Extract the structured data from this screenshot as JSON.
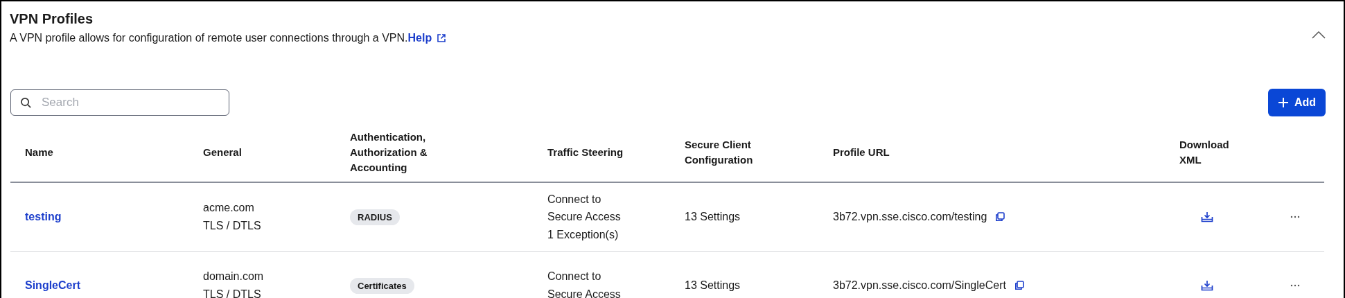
{
  "panel": {
    "title": "VPN Profiles",
    "description": "A VPN profile allows for configuration of remote user connections through a VPN.",
    "help_link": "Help",
    "expanded": true
  },
  "search": {
    "placeholder": "Search"
  },
  "add_button": {
    "label": "Add"
  },
  "table": {
    "columns": [
      "Name",
      "General",
      "Authentication, Authorization & Accounting",
      "Traffic Steering",
      "Secure Client Configuration",
      "Profile URL",
      "Download XML"
    ],
    "rows": [
      {
        "name": "testing",
        "general": [
          "acme.com",
          "TLS / DTLS"
        ],
        "aaa": "RADIUS",
        "traffic": [
          "Connect to",
          "Secure Access",
          "1 Exception(s)"
        ],
        "secure_client": "13 Settings",
        "profile_url": "3b72.vpn.sse.cisco.com/testing"
      },
      {
        "name": "SingleCert",
        "general": [
          "domain.com",
          "TLS / DTLS"
        ],
        "aaa": "Certificates",
        "traffic": [
          "Connect to",
          "Secure Access"
        ],
        "secure_client": "13 Settings",
        "profile_url": "3b72.vpn.sse.cisco.com/SingleCert"
      }
    ]
  }
}
